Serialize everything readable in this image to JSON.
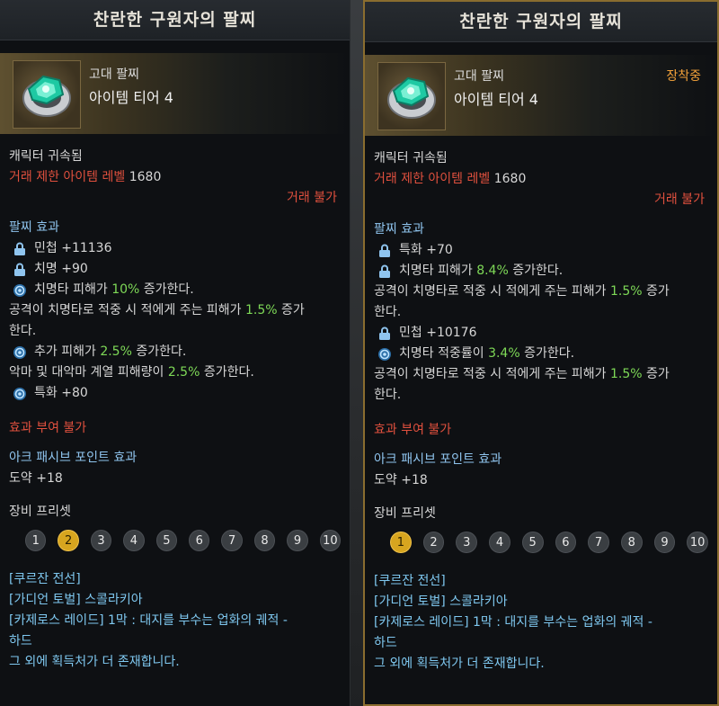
{
  "left": {
    "title": "찬란한 구원자의 팔찌",
    "grade": "고대 팔찌",
    "tier": "아이템 티어 4",
    "bound": "캐릭터 귀속됨",
    "trade_limit_label": "거래 제한 아이템 레벨",
    "trade_limit_value": "1680",
    "trade_status": "거래 불가",
    "effect_header": "팔찌 효과",
    "effects": {
      "e1": "민첩 +11136",
      "e2": "치명 +90",
      "e3_pre": "치명타 피해가 ",
      "e3_val": "10%",
      "e3_post": " 증가한다.",
      "e4_pre": "공격이 치명타로 적중 시 적에게 주는 피해가 ",
      "e4_val": "1.5%",
      "e4_post": " 증가",
      "e4_cont": "한다.",
      "e5_pre": "추가 피해가 ",
      "e5_val": "2.5%",
      "e5_post": " 증가한다.",
      "e6_pre": "악마 및 대악마 계열 피해량이 ",
      "e6_val": "2.5%",
      "e6_post": " 증가한다.",
      "e7": "특화 +80"
    },
    "no_effect": "효과 부여 불가",
    "ark_header": "아크 패시브 포인트 효과",
    "ark_value": "도약 +18",
    "preset_header": "장비 프리셋",
    "presets": [
      "1",
      "2",
      "3",
      "4",
      "5",
      "6",
      "7",
      "8",
      "9",
      "10"
    ],
    "sources": {
      "s1": "[쿠르잔 전선]",
      "s2": "[가디언 토벌] 스콜라키아",
      "s3": "[카제로스 레이드] 1막 : 대지를 부수는 업화의 궤적 -",
      "s3_cont": "하드",
      "s4": "그 외에 획득처가 더 존재합니다."
    }
  },
  "right": {
    "title": "찬란한 구원자의 팔찌",
    "grade": "고대 팔찌",
    "tier": "아이템 티어 4",
    "equipped": "장착중",
    "bound": "캐릭터 귀속됨",
    "trade_limit_label": "거래 제한 아이템 레벨",
    "trade_limit_value": "1680",
    "trade_status": "거래 불가",
    "effect_header": "팔찌 효과",
    "effects": {
      "e1": "특화 +70",
      "e2_pre": "치명타 피해가 ",
      "e2_val": "8.4%",
      "e2_post": " 증가한다.",
      "e3_pre": "공격이 치명타로 적중 시 적에게 주는 피해가 ",
      "e3_val": "1.5%",
      "e3_post": " 증가",
      "e3_cont": "한다.",
      "e4": "민첩 +10176",
      "e5_pre": "치명타 적중률이 ",
      "e5_val": "3.4%",
      "e5_post": " 증가한다.",
      "e6_pre": "공격이 치명타로 적중 시 적에게 주는 피해가 ",
      "e6_val": "1.5%",
      "e6_post": " 증가",
      "e6_cont": "한다."
    },
    "no_effect": "효과 부여 불가",
    "ark_header": "아크 패시브 포인트 효과",
    "ark_value": "도약 +18",
    "preset_header": "장비 프리셋",
    "presets": [
      "1",
      "2",
      "3",
      "4",
      "5",
      "6",
      "7",
      "8",
      "9",
      "10"
    ],
    "sources": {
      "s1": "[쿠르잔 전선]",
      "s2": "[가디언 토벌] 스콜라키아",
      "s3": "[카제로스 레이드] 1막 : 대지를 부수는 업화의 궤적 -",
      "s3_cont": "하드",
      "s4": "그 외에 획득처가 더 존재합니다."
    }
  },
  "icons": {
    "lock": "lock-icon",
    "random_effect": "swirl-icon",
    "bracelet": "bracelet-icon"
  },
  "colors": {
    "negative": "#e0503e",
    "positive": "#7ed957",
    "header": "#8fc4ee",
    "source": "#7fc8f0",
    "equipped": "#f2a13a",
    "active_preset": "#d7a51f"
  }
}
